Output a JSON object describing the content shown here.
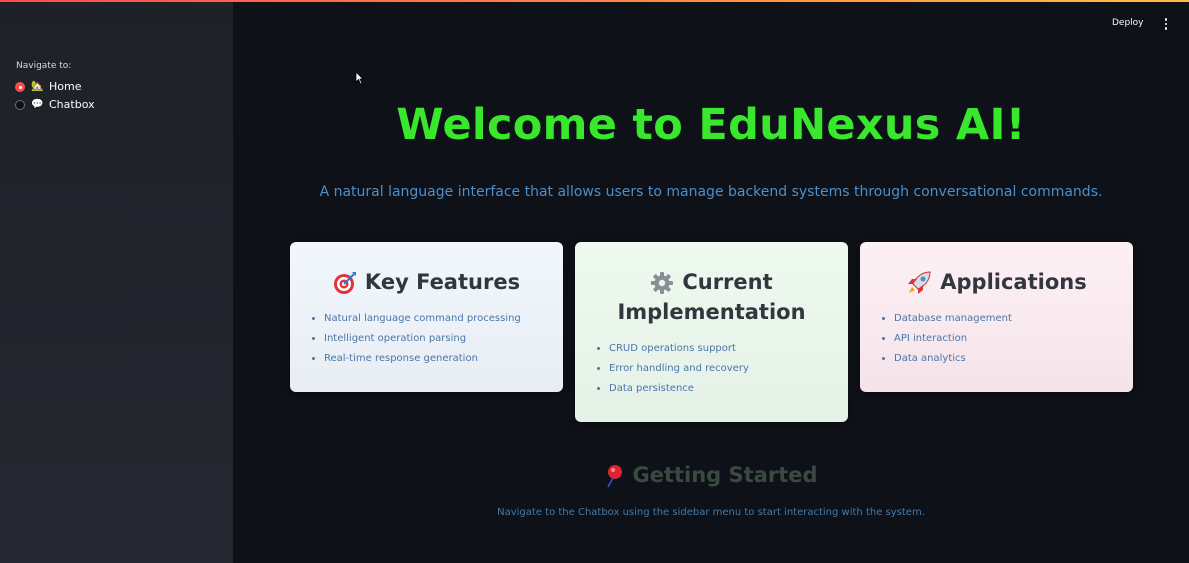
{
  "sidebar": {
    "nav_label": "Navigate to:",
    "options": [
      {
        "icon": "house-icon",
        "emoji": "🏡",
        "label": "Home",
        "selected": true
      },
      {
        "icon": "speech-bubble-icon",
        "emoji": "💬",
        "label": "Chatbox",
        "selected": false
      }
    ]
  },
  "header": {
    "deploy_label": "Deploy",
    "menu_icon": "kebab-menu-icon"
  },
  "main": {
    "title": "Welcome to EduNexus AI!",
    "subtitle": "A natural language interface that allows users to manage backend systems through conversational commands.",
    "cards": [
      {
        "icon": "target-icon",
        "title": "Key Features",
        "items": [
          "Natural language command processing",
          "Intelligent operation parsing",
          "Real-time response generation"
        ]
      },
      {
        "icon": "gear-icon",
        "title_line1": "Current",
        "title_line2": "Implementation",
        "items": [
          "CRUD operations support",
          "Error handling and recovery",
          "Data persistence"
        ]
      },
      {
        "icon": "rocket-icon",
        "title": "Applications",
        "items": [
          "Database management",
          "API interaction",
          "Data analytics"
        ]
      }
    ],
    "getting_started": {
      "icon": "pushpin-icon",
      "title": "Getting Started",
      "text": "Navigate to the Chatbox using the sidebar menu to start interacting with the system."
    }
  },
  "colors": {
    "accent": "#ff4b4b",
    "title_green": "#39e82d",
    "subtitle_blue": "#4f8ec8",
    "background": "#0e1117",
    "sidebar": "#262730"
  }
}
